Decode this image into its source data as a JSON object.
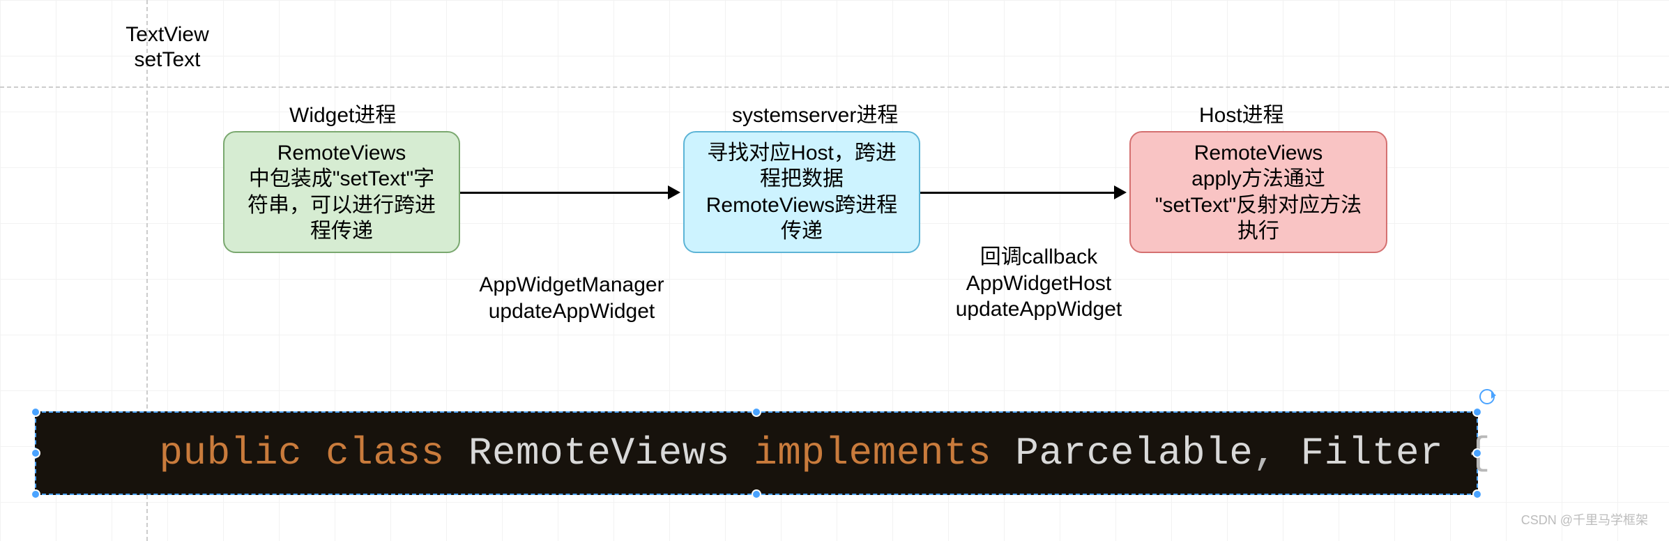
{
  "top_label": {
    "line1": "TextView",
    "line2": "setText"
  },
  "columns": {
    "widget": {
      "title": "Widget进程"
    },
    "server": {
      "title": "systemserver进程"
    },
    "host": {
      "title": "Host进程"
    }
  },
  "nodes": {
    "widget_node": {
      "l1": "RemoteViews",
      "l2": "中包装成\"setText\"字",
      "l3": "符串，可以进行跨进",
      "l4": "程传递"
    },
    "server_node": {
      "l1": "寻找对应Host，跨进",
      "l2": "程把数据",
      "l3": "RemoteViews跨进程",
      "l4": "传递"
    },
    "host_node": {
      "l1": "RemoteViews",
      "l2": "apply方法通过",
      "l3": "\"setText\"反射对应方法",
      "l4": "执行"
    }
  },
  "edges": {
    "a": {
      "l1": "AppWidgetManager",
      "l2": "updateAppWidget"
    },
    "b": {
      "l1": "回调callback",
      "l2": "AppWidgetHost",
      "l3": "updateAppWidget"
    }
  },
  "code": {
    "kw_public": "public",
    "kw_class": "class",
    "type_rv": "RemoteViews",
    "kw_impl": "implements",
    "type_parc": "Parcelable",
    "comma": ",",
    "type_filter": "Filter",
    "brace": "{"
  },
  "watermark": "CSDN @千里马学框架"
}
